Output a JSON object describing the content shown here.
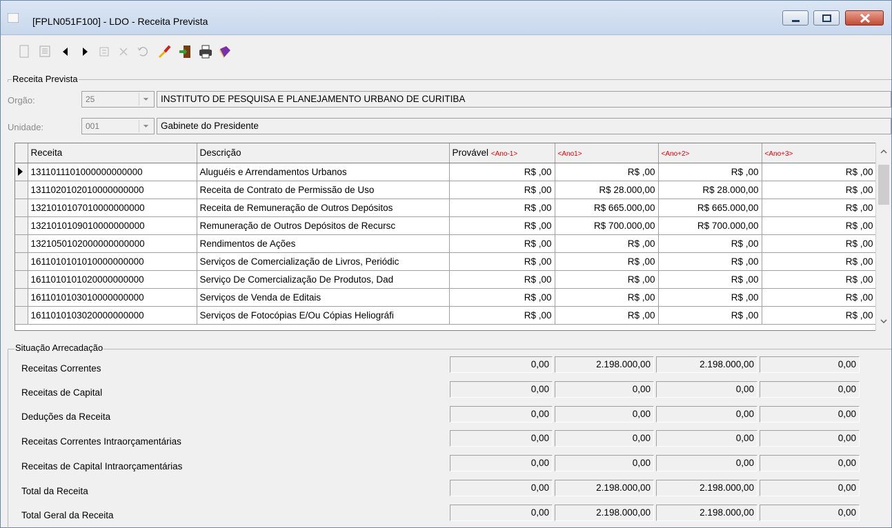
{
  "window": {
    "title": "[FPLN051F100] - LDO - Receita Prevista"
  },
  "toolbar": {
    "icons": [
      "new-icon",
      "save-icon",
      "prev-icon",
      "next-icon",
      "edit-icon",
      "delete-icon",
      "undo-icon",
      "clear-icon",
      "exit-icon",
      "print-icon",
      "help-book-icon"
    ]
  },
  "receita_prevista": {
    "group_label": "Receita Prevista",
    "orgao_label": "Orgão:",
    "orgao_code": "25",
    "orgao_name": "INSTITUTO DE PESQUISA E PLANEJAMENTO URBANO DE CURITIBA",
    "unidade_label": "Unidade:",
    "unidade_code": "001",
    "unidade_name": "Gabinete do Presidente"
  },
  "grid": {
    "headers": {
      "receita": "Receita",
      "descricao": "Descrição",
      "provavel": "Provável",
      "provavel_tag": "<Ano-1>",
      "ano1": "<Ano1>",
      "ano2": "<Ano+2>",
      "ano3": "<Ano+3>"
    },
    "rows": [
      {
        "receita": "1311011101000000000000",
        "descricao": "Aluguéis e Arrendamentos Urbanos",
        "provavel": "R$ ,00",
        "ano1": "R$ ,00",
        "ano2": "R$ ,00",
        "ano3": "R$ ,00"
      },
      {
        "receita": "1311020102010000000000",
        "descricao": "Receita de Contrato de Permissão de Uso",
        "provavel": "R$ ,00",
        "ano1": "R$ 28.000,00",
        "ano2": "R$ 28.000,00",
        "ano3": "R$ ,00"
      },
      {
        "receita": "1321010107010000000000",
        "descricao": "Receita de Remuneração de Outros Depósitos",
        "provavel": "R$ ,00",
        "ano1": "R$ 665.000,00",
        "ano2": "R$ 665.000,00",
        "ano3": "R$ ,00"
      },
      {
        "receita": "1321010109010000000000",
        "descricao": "Remuneração de Outros Depósitos de Recursc",
        "provavel": "R$ ,00",
        "ano1": "R$ 700.000,00",
        "ano2": "R$ 700.000,00",
        "ano3": "R$ ,00"
      },
      {
        "receita": "1321050102000000000000",
        "descricao": "Rendimentos de Ações",
        "provavel": "R$ ,00",
        "ano1": "R$ ,00",
        "ano2": "R$ ,00",
        "ano3": "R$ ,00"
      },
      {
        "receita": "1611010101010000000000",
        "descricao": "Serviços de Comercialização de Livros, Periódic",
        "provavel": "R$ ,00",
        "ano1": "R$ ,00",
        "ano2": "R$ ,00",
        "ano3": "R$ ,00"
      },
      {
        "receita": "1611010101020000000000",
        "descricao": "Serviço De Comercialização De Produtos, Dad",
        "provavel": "R$ ,00",
        "ano1": "R$ ,00",
        "ano2": "R$ ,00",
        "ano3": "R$ ,00"
      },
      {
        "receita": "1611010103010000000000",
        "descricao": "Serviços de Venda de Editais",
        "provavel": "R$ ,00",
        "ano1": "R$ ,00",
        "ano2": "R$ ,00",
        "ano3": "R$ ,00"
      },
      {
        "receita": "1611010103020000000000",
        "descricao": "Serviços de Fotocópias E/Ou Cópias Heliográfi",
        "provavel": "R$ ,00",
        "ano1": "R$ ,00",
        "ano2": "R$ ,00",
        "ano3": "R$ ,00"
      }
    ]
  },
  "situacao": {
    "group_label": "Situação Arrecadação",
    "rows": [
      {
        "label": "Receitas Correntes",
        "values": [
          "0,00",
          "2.198.000,00",
          "2.198.000,00",
          "0,00"
        ]
      },
      {
        "label": "Receitas de Capital",
        "values": [
          "0,00",
          "0,00",
          "0,00",
          "0,00"
        ]
      },
      {
        "label": "Deduções da Receita",
        "values": [
          "0,00",
          "0,00",
          "0,00",
          "0,00"
        ]
      },
      {
        "label": "Receitas Correntes Intraorçamentárias",
        "values": [
          "0,00",
          "0,00",
          "0,00",
          "0,00"
        ]
      },
      {
        "label": "Receitas de Capital Intraorçamentárias",
        "values": [
          "0,00",
          "0,00",
          "0,00",
          "0,00"
        ]
      },
      {
        "label": "Total da Receita",
        "values": [
          "0,00",
          "2.198.000,00",
          "2.198.000,00",
          "0,00"
        ]
      },
      {
        "label": "Total Geral da Receita",
        "values": [
          "0,00",
          "2.198.000,00",
          "2.198.000,00",
          "0,00"
        ]
      }
    ]
  }
}
